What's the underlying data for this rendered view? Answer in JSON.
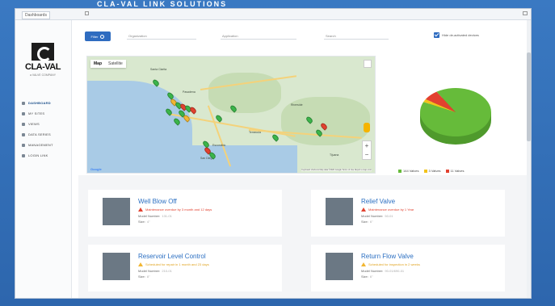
{
  "topbar": {
    "tab_label": "Dashboards",
    "header_text": "CLA-VAL LINK SOLUTIONS"
  },
  "logo": {
    "word": "CLA-VAL",
    "tag": "a VALVE COMPANY"
  },
  "sidebar": {
    "items": [
      {
        "label": "DASHBOARD",
        "active": true,
        "icon": "dashboard-icon"
      },
      {
        "label": "MY SITES",
        "active": false,
        "icon": "sites-icon"
      },
      {
        "label": "VIEWS",
        "active": false,
        "icon": "views-icon"
      },
      {
        "label": "DATA SERIES",
        "active": false,
        "icon": "series-icon"
      },
      {
        "label": "MANAGEMENT",
        "active": false,
        "icon": "management-icon"
      },
      {
        "label": "LOGIN LINK",
        "active": false,
        "icon": "login-icon"
      }
    ]
  },
  "toolbar": {
    "filter_label": "Filter",
    "select1_placeholder": "Organization",
    "select2_placeholder": "Application",
    "select3_placeholder": "Search",
    "checkbox_label": "Hide de-activated devices",
    "checkbox_checked": true
  },
  "map": {
    "tabs": [
      "Map",
      "Satellite"
    ],
    "active_tab": "Map",
    "places": [
      "Santa Clarita",
      "Pasadena",
      "Riverside",
      "Temecula",
      "Escondido",
      "San Diego",
      "Tijuana"
    ],
    "google_label": "Google",
    "footer": "Keyboard shortcuts   Map data ©2020 Google   Terms of Use   Report a map error",
    "zoom_in": "+",
    "zoom_out": "−"
  },
  "pie": {
    "colors": {
      "ok": "#66bb3a",
      "warn": "#f2c31b",
      "alert": "#e2412f"
    },
    "values": [
      91,
      2,
      7
    ],
    "legend": [
      "144 Valves",
      "3 Valves",
      "11 Valves"
    ]
  },
  "cards": [
    {
      "title": "Well Blow Off",
      "alert": "Maintenance overdue by 3 month and 12 days",
      "alert_type": "danger",
      "model_label": "Model Number:",
      "model_value": "131-01",
      "size_label": "Size:",
      "size_value": "4\""
    },
    {
      "title": "Relief Valve",
      "alert": "Maintenance overdue by 1 Year",
      "alert_type": "danger",
      "model_label": "Model Number:",
      "model_value": "50-01",
      "size_label": "Size:",
      "size_value": "6\""
    },
    {
      "title": "Reservoir Level Control",
      "alert": "Scheduled for repair in 1 month and 23 days",
      "alert_type": "warn",
      "model_label": "Model Number:",
      "model_value": "210-01",
      "size_label": "Size:",
      "size_value": "8\""
    },
    {
      "title": "Return Flow Valve",
      "alert": "Scheduled for inspection in 2 weeks",
      "alert_type": "warn",
      "model_label": "Model Number:",
      "model_value": "90-01/690-01",
      "size_label": "Size:",
      "size_value": "6\""
    }
  ]
}
